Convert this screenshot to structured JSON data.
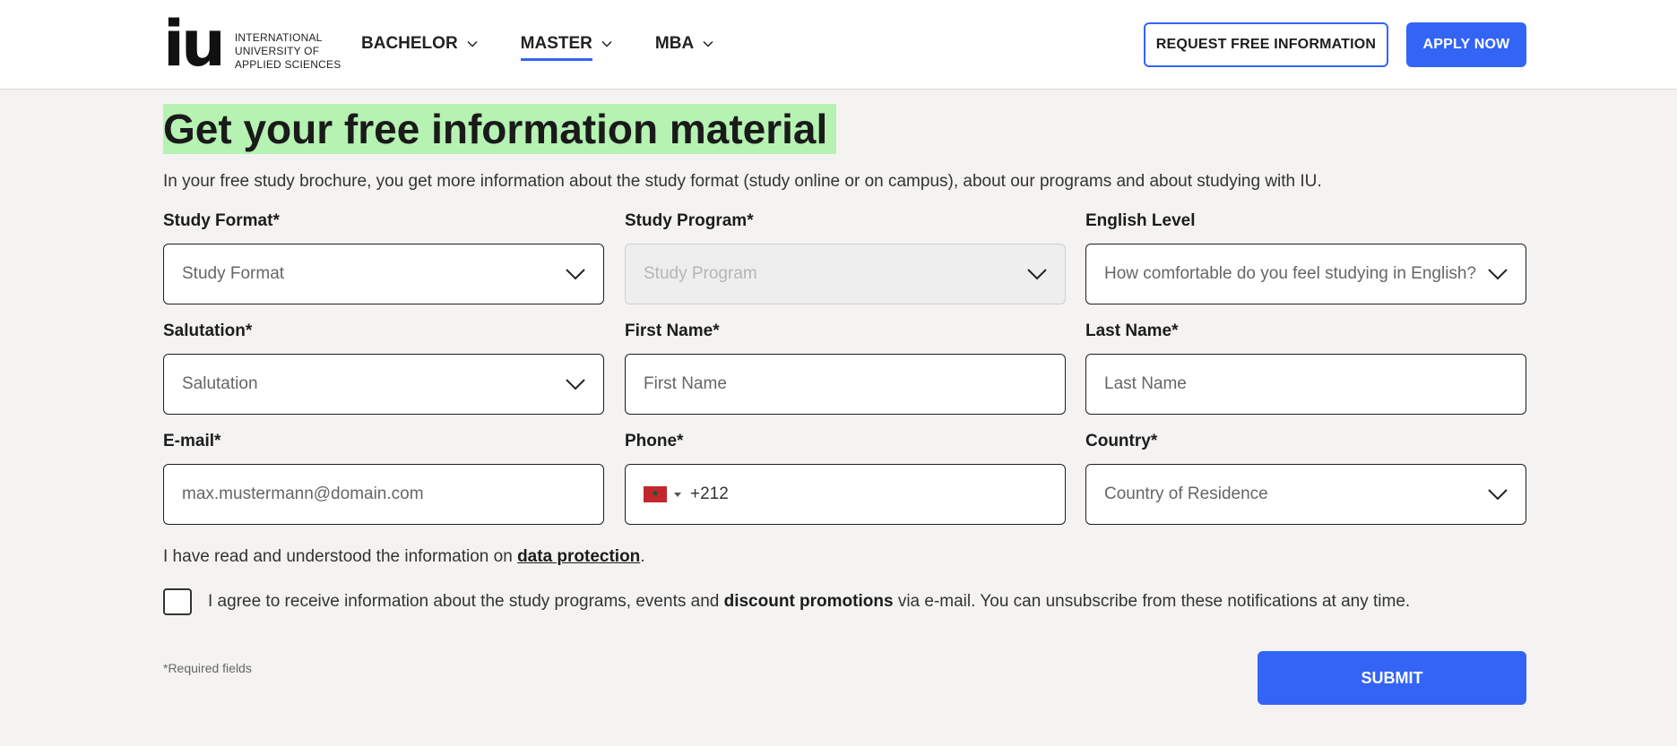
{
  "header": {
    "logo_mark": "iu",
    "logo_lines": [
      "INTERNATIONAL",
      "UNIVERSITY OF",
      "APPLIED SCIENCES"
    ],
    "nav": [
      {
        "label": "BACHELOR",
        "active": false
      },
      {
        "label": "MASTER",
        "active": true
      },
      {
        "label": "MBA",
        "active": false
      }
    ],
    "request_info_label": "REQUEST FREE INFORMATION",
    "apply_label": "APPLY NOW"
  },
  "form": {
    "title": "Get your free information material",
    "intro": "In your free study brochure, you get more information about the study format (study online or on campus), about our programs and about studying with IU.",
    "study_format": {
      "label": "Study Format*",
      "placeholder": "Study Format"
    },
    "study_program": {
      "label": "Study Program*",
      "placeholder": "Study Program"
    },
    "english_level": {
      "label": "English Level",
      "placeholder": "How comfortable do you feel studying in English?"
    },
    "salutation": {
      "label": "Salutation*",
      "placeholder": "Salutation"
    },
    "first_name": {
      "label": "First Name*",
      "placeholder": "First Name"
    },
    "last_name": {
      "label": "Last Name*",
      "placeholder": "Last Name"
    },
    "email": {
      "label": "E-mail*",
      "placeholder": "max.mustermann@domain.com"
    },
    "phone": {
      "label": "Phone*",
      "value": "+212",
      "flag_symbol": "★"
    },
    "country": {
      "label": "Country*",
      "placeholder": "Country of Residence"
    },
    "privacy_prefix": "I have read and understood the information on ",
    "privacy_link": "data protection",
    "privacy_suffix": ".",
    "consent_prefix": "I agree to receive information about the study programs, events and ",
    "consent_bold": "discount promotions",
    "consent_suffix": " via e-mail. You can unsubscribe from these notifications at any time.",
    "required_note": "*Required fields",
    "submit_label": "SUBMIT"
  },
  "colors": {
    "accent": "#3464f6",
    "title_highlight": "#b6f2b2",
    "background": "#f4f3f2"
  }
}
